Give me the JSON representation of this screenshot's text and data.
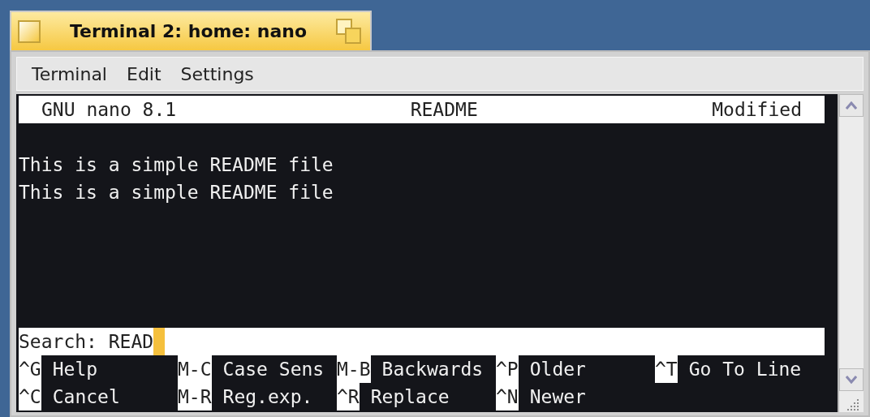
{
  "window": {
    "title": "Terminal 2: home: nano"
  },
  "menu": [
    "Terminal",
    "Edit",
    "Settings"
  ],
  "nano": {
    "header": {
      "version": "GNU nano 8.1",
      "filename": "README",
      "status": "Modified"
    },
    "lines": [
      "This is a simple README file",
      "This is a simple README file"
    ],
    "prompt": {
      "label": "Search:",
      "value": "READ"
    },
    "shortcuts": [
      [
        {
          "key": "^G",
          "label": "Help"
        },
        {
          "key": "M-C",
          "label": "Case Sens"
        },
        {
          "key": "M-B",
          "label": "Backwards"
        },
        {
          "key": "^P",
          "label": "Older"
        },
        {
          "key": "^T",
          "label": "Go To Line"
        }
      ],
      [
        {
          "key": "^C",
          "label": "Cancel"
        },
        {
          "key": "M-R",
          "label": "Reg.exp."
        },
        {
          "key": "^R",
          "label": "Replace"
        },
        {
          "key": "^N",
          "label": "Newer"
        }
      ]
    ]
  }
}
